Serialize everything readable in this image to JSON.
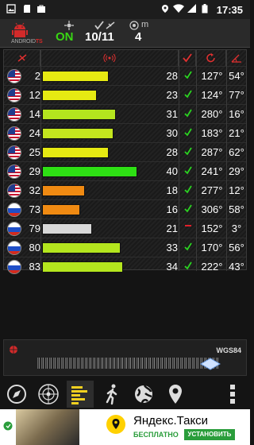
{
  "status_bar": {
    "time": "17:35",
    "icons": [
      "gallery-icon",
      "sd-card-icon",
      "shopping-bag-icon",
      "location-pin-icon",
      "wifi-icon",
      "signal-icon",
      "battery-icon"
    ]
  },
  "header": {
    "logo_text_prefix": "ANDROID",
    "logo_text_suffix": "TS",
    "fix_status": "ON",
    "satellites_used_total": "10/11",
    "count": "4",
    "unit": "m"
  },
  "columns": [
    "flag",
    "prn",
    "signal",
    "used",
    "azimuth",
    "elevation"
  ],
  "satellites": [
    {
      "flag": "usa",
      "prn": "2",
      "snr": "28",
      "snr_value": 28,
      "color": "#e6ea12",
      "used": true,
      "azimuth": "127°",
      "elevation": "54°"
    },
    {
      "flag": "usa",
      "prn": "12",
      "snr": "23",
      "snr_value": 23,
      "color": "#e6ea12",
      "used": true,
      "azimuth": "124°",
      "elevation": "77°"
    },
    {
      "flag": "usa",
      "prn": "14",
      "snr": "31",
      "snr_value": 31,
      "color": "#b4e61e",
      "used": true,
      "azimuth": "280°",
      "elevation": "16°"
    },
    {
      "flag": "usa",
      "prn": "24",
      "snr": "30",
      "snr_value": 30,
      "color": "#c4e61e",
      "used": true,
      "azimuth": "183°",
      "elevation": "21°"
    },
    {
      "flag": "usa",
      "prn": "25",
      "snr": "28",
      "snr_value": 28,
      "color": "#e6ea12",
      "used": true,
      "azimuth": "287°",
      "elevation": "62°"
    },
    {
      "flag": "usa",
      "prn": "29",
      "snr": "40",
      "snr_value": 40,
      "color": "#2ee014",
      "used": true,
      "azimuth": "241°",
      "elevation": "29°"
    },
    {
      "flag": "usa",
      "prn": "32",
      "snr": "18",
      "snr_value": 18,
      "color": "#f08a12",
      "used": true,
      "azimuth": "277°",
      "elevation": "12°"
    },
    {
      "flag": "rus",
      "prn": "73",
      "snr": "16",
      "snr_value": 16,
      "color": "#f08a12",
      "used": true,
      "azimuth": "306°",
      "elevation": "58°"
    },
    {
      "flag": "rus",
      "prn": "79",
      "snr": "21",
      "snr_value": 21,
      "color": "#d8d8d8",
      "used": false,
      "azimuth": "152°",
      "elevation": "3°"
    },
    {
      "flag": "rus",
      "prn": "80",
      "snr": "33",
      "snr_value": 33,
      "color": "#b4e61e",
      "used": true,
      "azimuth": "170°",
      "elevation": "56°"
    },
    {
      "flag": "rus",
      "prn": "83",
      "snr": "34",
      "snr_value": 34,
      "color": "#b4e61e",
      "used": true,
      "azimuth": "222°",
      "elevation": "43°"
    }
  ],
  "snr_max": 50,
  "datum": "WGS84",
  "toolbar": [
    "compass-icon",
    "sky-view-icon",
    "signal-bars-icon",
    "walking-icon",
    "globe-icon",
    "map-pin-icon",
    "more-vertical-icon"
  ],
  "ad": {
    "title": "Яндекс.Такси",
    "free_label": "БЕСПЛАТНО",
    "install_label": "УСТАНОВИТЬ"
  },
  "colors": {
    "fix_on": "#39d614",
    "used_check": "#2bd421",
    "not_used": "#e0202a",
    "header_icons": "#e03030"
  }
}
